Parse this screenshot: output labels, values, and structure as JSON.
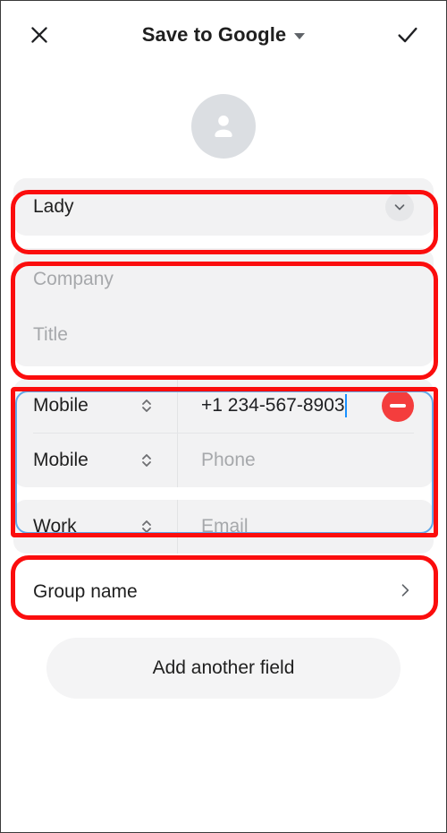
{
  "appbar": {
    "close_icon": "close-icon",
    "title": "Save to Google",
    "dropdown_icon": "caret-down-icon",
    "confirm_icon": "check-icon"
  },
  "avatar": {
    "icon": "person-icon"
  },
  "name_field": {
    "value": "Lady",
    "expand_icon": "chevron-down-icon"
  },
  "organization": {
    "company_placeholder": "Company",
    "title_placeholder": "Title"
  },
  "phones": [
    {
      "type": "Mobile",
      "value": "+1 234-567-8903",
      "placeholder": "Phone",
      "has_value": true,
      "remove_icon": "minus-circle-icon"
    },
    {
      "type": "Mobile",
      "value": "",
      "placeholder": "Phone",
      "has_value": false
    }
  ],
  "email": {
    "type": "Work",
    "placeholder": "Email"
  },
  "group_row": {
    "label": "Group name",
    "chevron_icon": "chevron-right-icon"
  },
  "add_field_button": {
    "label": "Add another field"
  },
  "colors": {
    "annotation": "#fb0d0d",
    "focus_ring": "#60a8e8",
    "remove_button": "#f43d3d",
    "text_cursor": "#1a90ff",
    "field_background": "#f2f2f3"
  }
}
